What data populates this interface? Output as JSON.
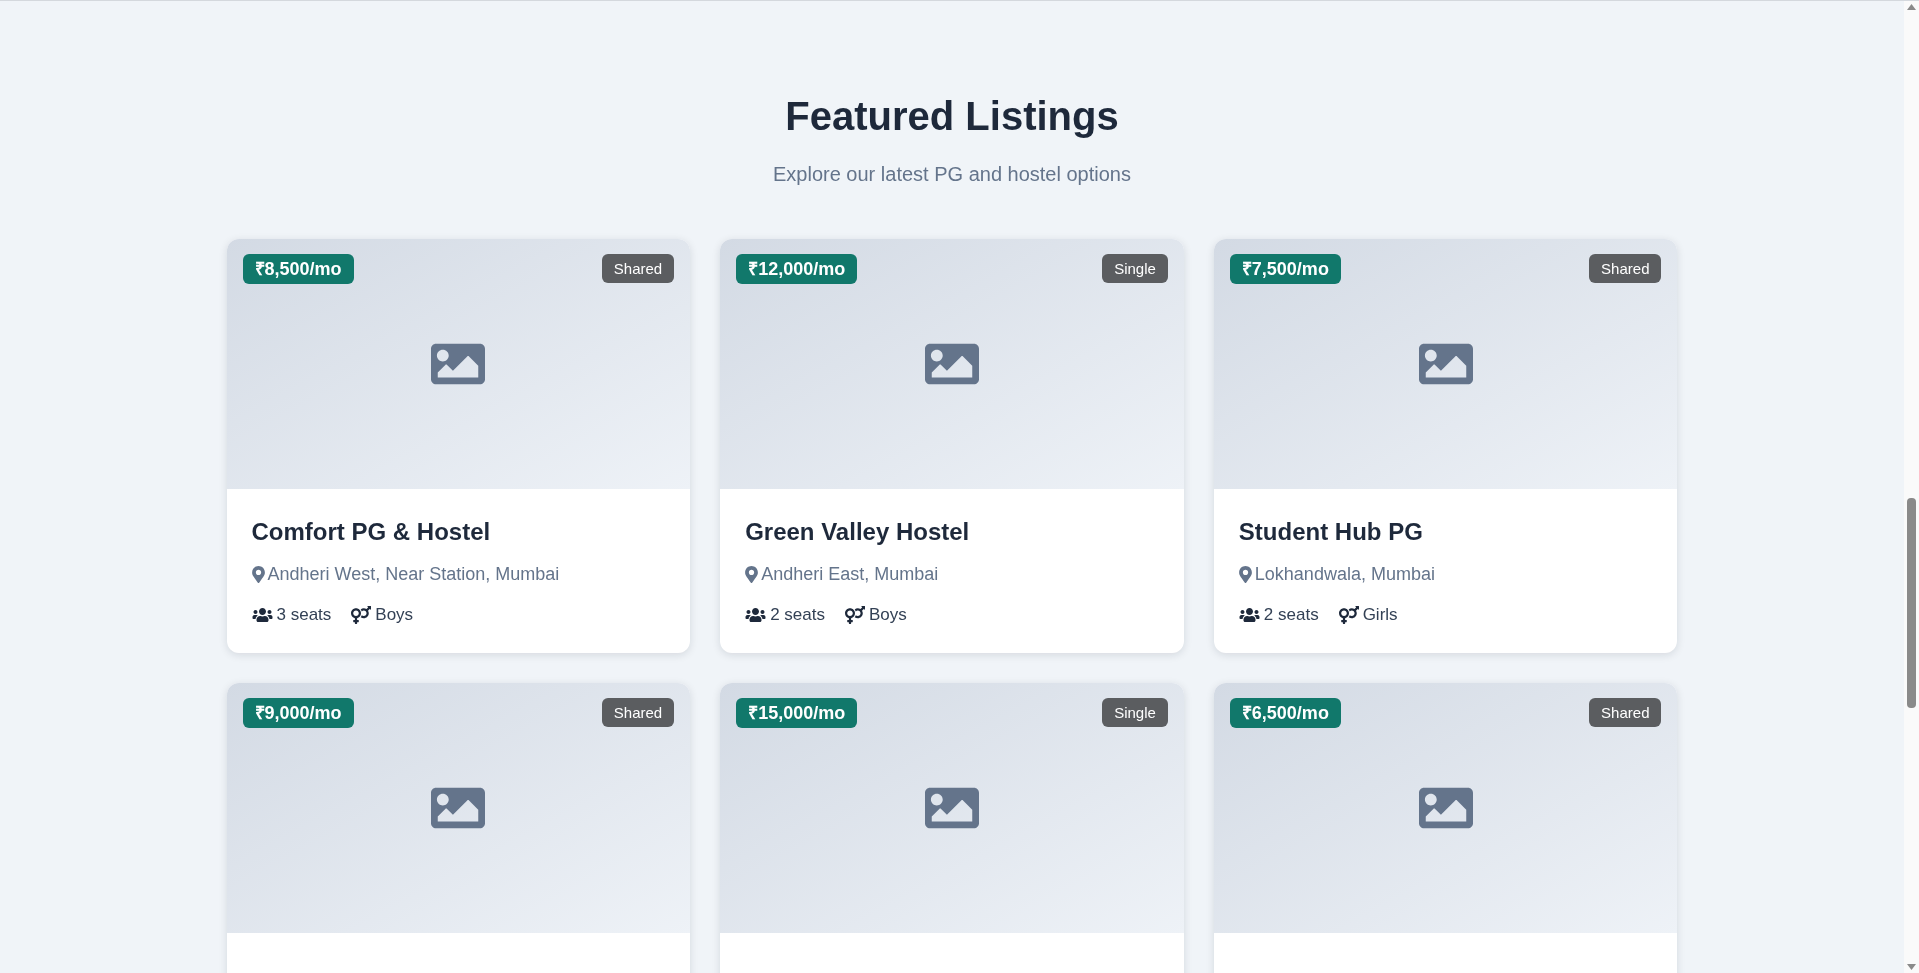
{
  "header": {
    "title": "Featured Listings",
    "subtitle": "Explore our latest PG and hostel options"
  },
  "listings": [
    {
      "price": "₹8,500/mo",
      "type": "Shared",
      "title": "Comfort PG & Hostel",
      "location": "Andheri West, Near Station, Mumbai",
      "seats": "3 seats",
      "gender": "Boys"
    },
    {
      "price": "₹12,000/mo",
      "type": "Single",
      "title": "Green Valley Hostel",
      "location": "Andheri East, Mumbai",
      "seats": "2 seats",
      "gender": "Boys"
    },
    {
      "price": "₹7,500/mo",
      "type": "Shared",
      "title": "Student Hub PG",
      "location": "Lokhandwala, Mumbai",
      "seats": "2 seats",
      "gender": "Girls"
    },
    {
      "price": "₹9,000/mo",
      "type": "Shared"
    },
    {
      "price": "₹15,000/mo",
      "type": "Single"
    },
    {
      "price": "₹6,500/mo",
      "type": "Shared"
    }
  ]
}
